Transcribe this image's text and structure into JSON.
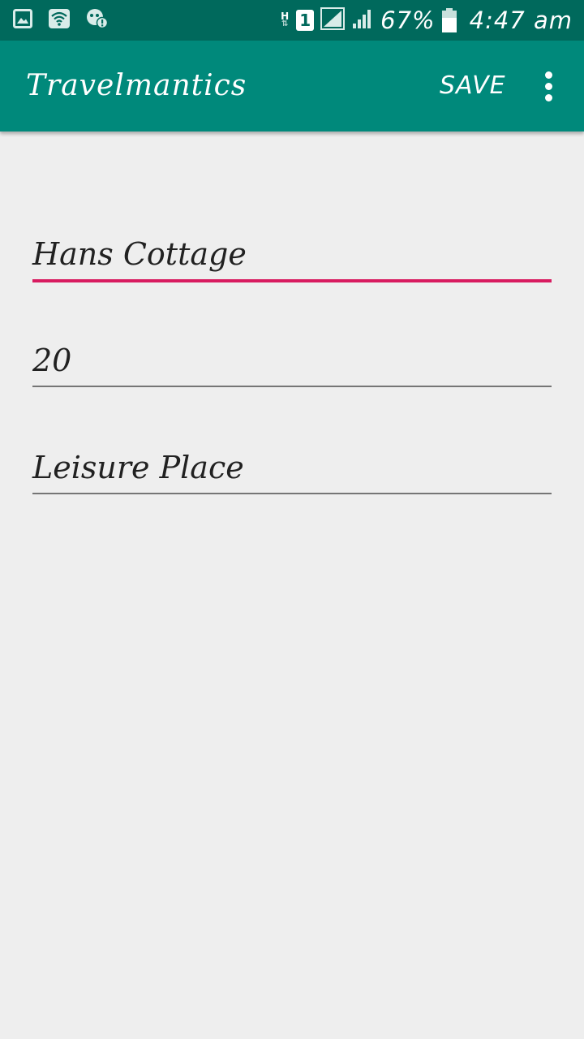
{
  "status_bar": {
    "network_type": "H",
    "sim_slot": "1",
    "battery_percent": "67%",
    "time": "4:47 am",
    "icons": [
      "gallery-icon",
      "wifi-icon",
      "data-saver-icon",
      "hplus-icon",
      "sim-icon",
      "signal-icon",
      "signal-icon",
      "battery-icon"
    ]
  },
  "app_bar": {
    "title": "Travelmantics",
    "save_label": "SAVE",
    "overflow_icon": "more-vert-icon",
    "background_color": "#00897b"
  },
  "form": {
    "title_value": "Hans Cottage",
    "price_value": "20",
    "description_value": "Leisure Place",
    "accent_color": "#d81b60"
  }
}
